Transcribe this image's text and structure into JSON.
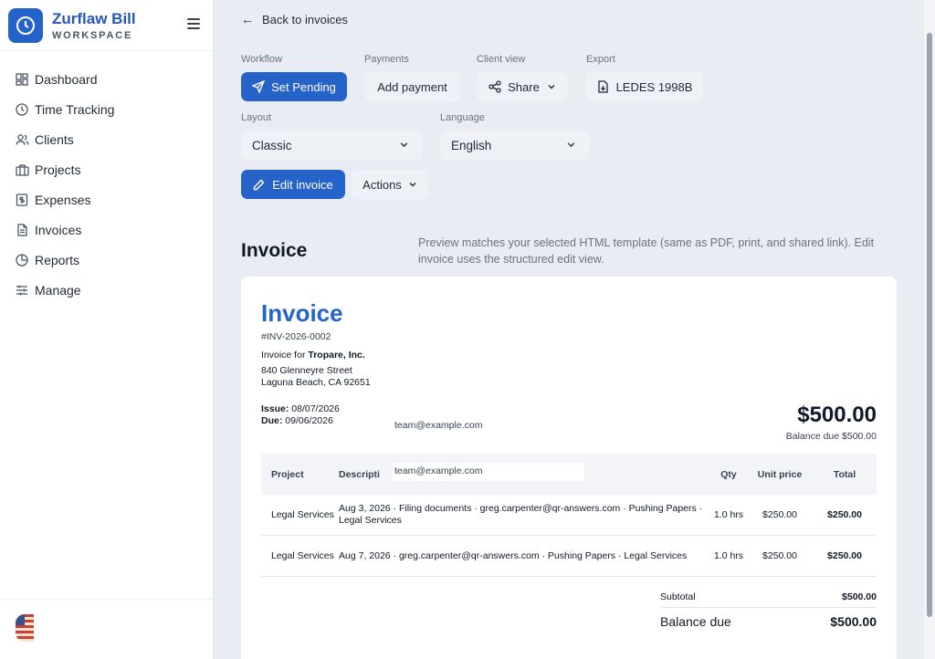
{
  "brand": {
    "name": "Zurflaw Bill",
    "sub": "WORKSPACE"
  },
  "nav": [
    {
      "label": "Dashboard",
      "icon": "grid-icon"
    },
    {
      "label": "Time Tracking",
      "icon": "clock-icon"
    },
    {
      "label": "Clients",
      "icon": "users-icon"
    },
    {
      "label": "Projects",
      "icon": "briefcase-icon"
    },
    {
      "label": "Expenses",
      "icon": "receipt-icon"
    },
    {
      "label": "Invoices",
      "icon": "file-icon"
    },
    {
      "label": "Reports",
      "icon": "pie-icon"
    },
    {
      "label": "Manage",
      "icon": "sliders-icon"
    }
  ],
  "back_label": "Back to invoices",
  "toolbar": {
    "workflow_label": "Workflow",
    "set_pending": "Set Pending",
    "payments_label": "Payments",
    "add_payment": "Add payment",
    "client_view_label": "Client view",
    "share": "Share",
    "export_label": "Export",
    "ledes": "LEDES 1998B",
    "layout_label": "Layout",
    "layout_value": "Classic",
    "language_label": "Language",
    "language_value": "English",
    "edit_invoice": "Edit invoice",
    "actions": "Actions"
  },
  "section": {
    "title": "Invoice",
    "note": "Preview matches your selected HTML template (same as PDF, print, and shared link). Edit invoice uses the structured edit view."
  },
  "invoice": {
    "title": "Invoice",
    "number": "#INV-2026-0002",
    "for_prefix": "Invoice for ",
    "client": "Tropare, Inc.",
    "address_line1": "840 Glenneyre Street",
    "address_line2": "Laguna Beach, CA 92651",
    "issue_label": "Issue:",
    "issue_date": "08/07/2026",
    "due_label": "Due:",
    "due_date": "09/06/2026",
    "team_email": "team@example.com",
    "amount": "$500.00",
    "balance_due_line": "Balance due $500.00",
    "columns": {
      "project": "Project",
      "description": "Descripti",
      "qty": "Qty",
      "unit_price": "Unit price",
      "total": "Total"
    },
    "rows": [
      {
        "project": "Legal Services",
        "description": "Aug 3, 2026 · Filing documents · greg.carpenter@qr-answers.com · Pushing Papers · Legal Services",
        "qty": "1.0 hrs",
        "unit_price": "$250.00",
        "total": "$250.00"
      },
      {
        "project": "Legal Services",
        "description": "Aug 7, 2026 · greg.carpenter@qr-answers.com · Pushing Papers · Legal Services",
        "qty": "1.0 hrs",
        "unit_price": "$250.00",
        "total": "$250.00"
      }
    ],
    "subtotal_label": "Subtotal",
    "subtotal": "$500.00",
    "balance_label": "Balance due",
    "balance": "$500.00"
  },
  "colors": {
    "accent": "#2563c9",
    "background": "#e9edf3"
  }
}
